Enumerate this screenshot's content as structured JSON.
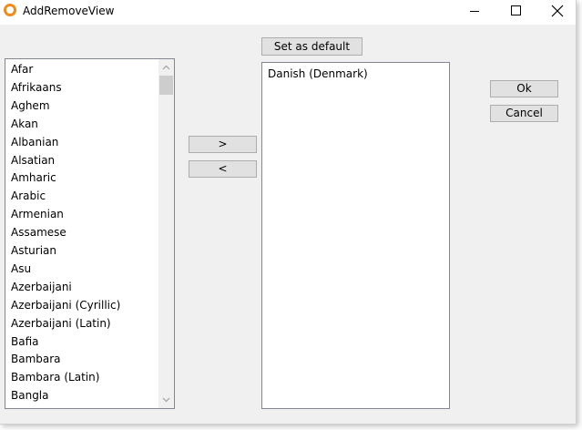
{
  "window": {
    "title": "AddRemoveView",
    "accent": "#f08c1c"
  },
  "titlebar_icons": [
    "app-icon",
    "minimize-icon",
    "maximize-icon",
    "close-icon"
  ],
  "buttons": {
    "set_default": "Set as default",
    "add": ">",
    "remove": "<",
    "ok": "Ok",
    "cancel": "Cancel"
  },
  "available_languages": [
    "Afar",
    "Afrikaans",
    "Aghem",
    "Akan",
    "Albanian",
    "Alsatian",
    "Amharic",
    "Arabic",
    "Armenian",
    "Assamese",
    "Asturian",
    "Asu",
    "Azerbaijani",
    "Azerbaijani (Cyrillic)",
    "Azerbaijani (Latin)",
    "Bafia",
    "Bambara",
    "Bambara (Latin)",
    "Bangla"
  ],
  "selected_languages": [
    "Danish (Denmark)"
  ]
}
